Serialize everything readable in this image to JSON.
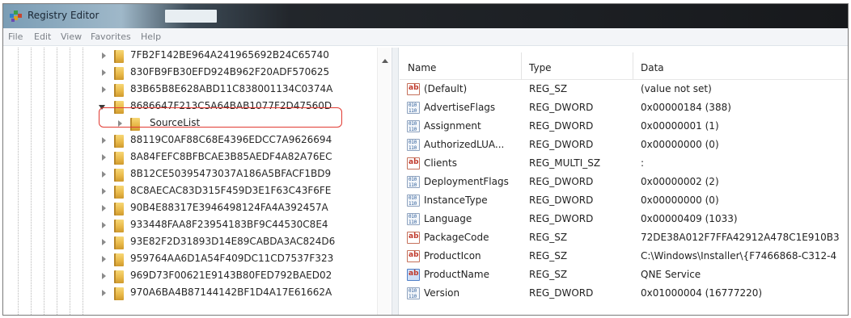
{
  "window": {
    "title": "Registry Editor"
  },
  "menu": [
    "File",
    "Edit",
    "View",
    "Favorites",
    "Help"
  ],
  "tree": {
    "items": [
      {
        "label": "7FB2F142BE964A241965692B24C65740"
      },
      {
        "label": "830FB9FB30EFD924B962F20ADF570625"
      },
      {
        "label": "83B65B8E628ABD11C838001134C0374A"
      },
      {
        "label": "8686647F213C5A64BAB1077F2D47560D"
      },
      {
        "label": "SourceList"
      },
      {
        "label": "88119C0AF88C68E4396EDCC7A9626694"
      },
      {
        "label": "8A84FEFC8BFBCAE3B85AEDF4A82A76EC"
      },
      {
        "label": "8B12CE50395473037A186A5BFACF1BD9"
      },
      {
        "label": "8C8AECAC83D315F459D3E1F63C43F6FE"
      },
      {
        "label": "90B4E88317E3946498124FA4A392457A"
      },
      {
        "label": "933448FAA8F23954183BF9C44530C8E4"
      },
      {
        "label": "93E82F2D31893D14E89CABDA3AC824D6"
      },
      {
        "label": "959764AA6D1A54F409DC11CD7537F323"
      },
      {
        "label": "969D73F00621E9143B80FED792BAED02"
      },
      {
        "label": "970A6BA4B87144142BF1D4A17E61662A"
      }
    ]
  },
  "list": {
    "columns": {
      "name": "Name",
      "type": "Type",
      "data": "Data"
    },
    "rows": [
      {
        "icon": "string-value-icon",
        "name": "(Default)",
        "type": "REG_SZ",
        "data": "(value not set)"
      },
      {
        "icon": "binary-value-icon",
        "name": "AdvertiseFlags",
        "type": "REG_DWORD",
        "data": "0x00000184 (388)"
      },
      {
        "icon": "binary-value-icon",
        "name": "Assignment",
        "type": "REG_DWORD",
        "data": "0x00000001 (1)"
      },
      {
        "icon": "binary-value-icon",
        "name": "AuthorizedLUA...",
        "type": "REG_DWORD",
        "data": "0x00000000 (0)"
      },
      {
        "icon": "string-value-icon",
        "name": "Clients",
        "type": "REG_MULTI_SZ",
        "data": ":"
      },
      {
        "icon": "binary-value-icon",
        "name": "DeploymentFlags",
        "type": "REG_DWORD",
        "data": "0x00000002 (2)"
      },
      {
        "icon": "binary-value-icon",
        "name": "InstanceType",
        "type": "REG_DWORD",
        "data": "0x00000000 (0)"
      },
      {
        "icon": "binary-value-icon",
        "name": "Language",
        "type": "REG_DWORD",
        "data": "0x00000409 (1033)"
      },
      {
        "icon": "string-value-icon",
        "name": "PackageCode",
        "type": "REG_SZ",
        "data": "72DE38A012F7FFA42912A478C1E910B3"
      },
      {
        "icon": "string-value-icon",
        "name": "ProductIcon",
        "type": "REG_SZ",
        "data": "C:\\Windows\\Installer\\{F7466868-C312-4"
      },
      {
        "icon": "string-value-icon",
        "name": "ProductName",
        "type": "REG_SZ",
        "data": "QNE Service"
      },
      {
        "icon": "binary-value-icon",
        "name": "Version",
        "type": "REG_DWORD",
        "data": "0x01000004 (16777220)"
      }
    ]
  },
  "colors": {
    "highlight": "#e13a32",
    "folder": "#e9b94a"
  }
}
